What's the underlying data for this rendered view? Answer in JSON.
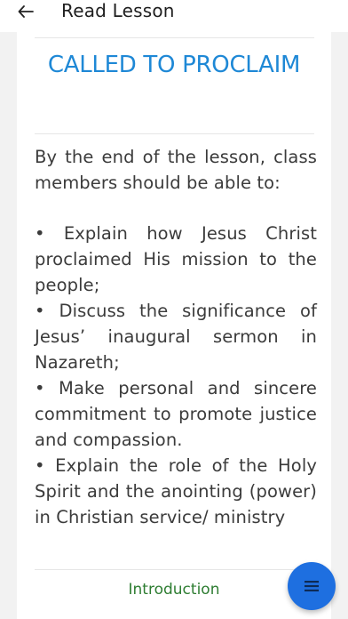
{
  "appbar": {
    "back_icon": "arrow-left-icon",
    "title": "Read Lesson"
  },
  "lesson": {
    "title": "CALLED TO PROCLAIM",
    "intro": "By the end of the lesson, class members should be able to:",
    "objectives": [
      "• Explain how Jesus Christ proclaimed His mission to the people;",
      "• Discuss the significance of Jesus’ inaugural sermon in Nazareth;",
      "• Make personal and sincere commitment to promote justice and compassion.",
      "• Explain the role of the Holy Spirit and the anointing (power) in Christian service/ ministry"
    ]
  },
  "footer": {
    "section_link": "Introduction",
    "fab_icon": "menu-icon"
  },
  "colors": {
    "title": "#1e88d6",
    "link": "#2e7d32",
    "fab": "#1e6fe0",
    "page_bg": "#f2f2f2"
  }
}
